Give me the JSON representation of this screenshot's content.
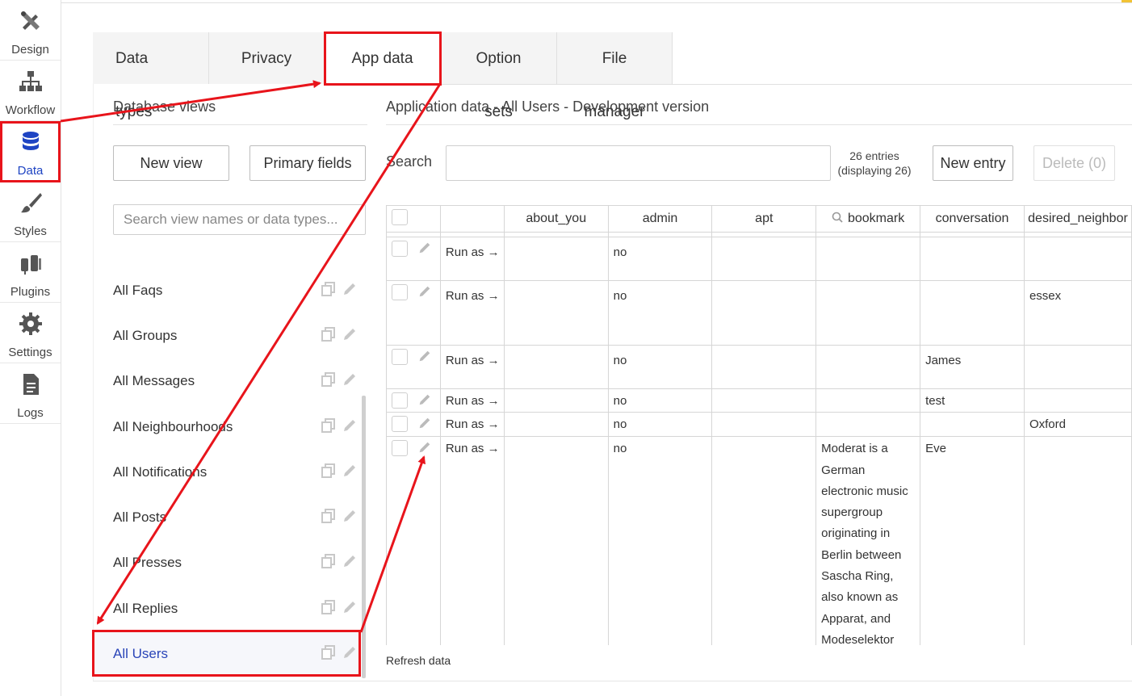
{
  "sidebar": {
    "items": [
      {
        "label": "Design",
        "icon": "design-icon"
      },
      {
        "label": "Workflow",
        "icon": "workflow-icon"
      },
      {
        "label": "Data",
        "icon": "database-icon",
        "active": true
      },
      {
        "label": "Styles",
        "icon": "brush-icon"
      },
      {
        "label": "Plugins",
        "icon": "plug-icon"
      },
      {
        "label": "Settings",
        "icon": "gear-icon"
      },
      {
        "label": "Logs",
        "icon": "document-icon"
      }
    ]
  },
  "tabs": [
    {
      "label": "Data types"
    },
    {
      "label": "Privacy"
    },
    {
      "label": "App data",
      "active": true
    },
    {
      "label": "Option sets"
    },
    {
      "label": "File manager"
    }
  ],
  "left_panel": {
    "title": "Database views",
    "new_view_label": "New view",
    "primary_fields_label": "Primary fields",
    "search_placeholder": "Search view names or data types...",
    "views": [
      {
        "label": "All Faqs"
      },
      {
        "label": "All Groups"
      },
      {
        "label": "All Messages"
      },
      {
        "label": "All Neighbourhoods"
      },
      {
        "label": "All Notifications"
      },
      {
        "label": "All Posts"
      },
      {
        "label": "All Presses"
      },
      {
        "label": "All Replies"
      },
      {
        "label": "All Users",
        "active": true
      }
    ]
  },
  "main": {
    "title": "Application data - All Users - Development version",
    "search_label": "Search",
    "entries_count": "26 entries",
    "entries_display": "(displaying 26)",
    "new_entry_label": "New entry",
    "delete_label": "Delete (0)",
    "refresh_label": "Refresh data",
    "columns": [
      "about_you",
      "admin",
      "apt",
      "bookmark",
      "conversation",
      "desired_neighbor"
    ],
    "rows": [
      {
        "run_as": "Run as →",
        "about_you": "",
        "admin": "no",
        "apt": "",
        "bookmark": "",
        "conversation": "",
        "desired_neighbor": ""
      },
      {
        "run_as": "Run as →",
        "about_you": "",
        "admin": "no",
        "apt": "",
        "bookmark": "",
        "conversation": "",
        "desired_neighbor": "essex"
      },
      {
        "run_as": "Run as →",
        "about_you": "",
        "admin": "no",
        "apt": "",
        "bookmark": "",
        "conversation": "James",
        "desired_neighbor": ""
      },
      {
        "run_as": "Run as →",
        "about_you": "",
        "admin": "no",
        "apt": "",
        "bookmark": "",
        "conversation": "test",
        "desired_neighbor": ""
      },
      {
        "run_as": "Run as →",
        "about_you": "",
        "admin": "no",
        "apt": "",
        "bookmark": "",
        "conversation": "",
        "desired_neighbor": "Oxford"
      },
      {
        "run_as": "Run as →",
        "about_you": "",
        "admin": "no",
        "apt": "",
        "bookmark": "Moderat is a German electronic music supergroup originating in Berlin between Sascha Ring, also known as Apparat, and Modeselektor",
        "conversation": "Eve",
        "desired_neighbor": ""
      }
    ]
  },
  "colors": {
    "accent": "#1e44c3",
    "annotation": "#e8141b"
  }
}
